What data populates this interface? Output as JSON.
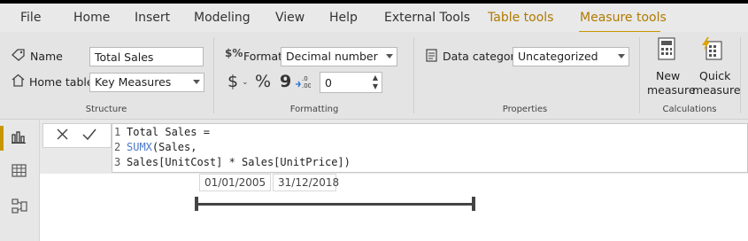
{
  "menu": {
    "items": [
      "File",
      "Home",
      "Insert",
      "Modeling",
      "View",
      "Help",
      "External Tools",
      "Table tools",
      "Measure tools"
    ],
    "active": "Measure tools"
  },
  "ribbon": {
    "structure": {
      "name_label": "Name",
      "name_value": "Total Sales",
      "home_table_label": "Home table",
      "home_table_value": "Key Measures",
      "title": "Structure"
    },
    "formatting": {
      "format_label": "Format",
      "format_value": "Decimal number",
      "currency_symbol": "$",
      "percent_symbol": "%",
      "comma_symbol": "9",
      "decimals_value": "0",
      "title": "Formatting"
    },
    "properties": {
      "data_category_label": "Data category",
      "data_category_value": "Uncategorized",
      "title": "Properties"
    },
    "calculations": {
      "new_measure_line1": "New",
      "new_measure_line2": "measure",
      "quick_measure_line1": "Quick",
      "quick_measure_line2": "measure",
      "title": "Calculations"
    }
  },
  "formula": {
    "lines": [
      {
        "num": "1",
        "text": "Total Sales ="
      },
      {
        "num": "2",
        "kw": "SUMX",
        "rest": "(Sales,"
      },
      {
        "num": "3",
        "text": "Sales[UnitCost] * Sales[UnitPrice])"
      }
    ]
  },
  "slicer": {
    "start_date": "01/01/2005",
    "end_date": "31/12/2018"
  },
  "colors": {
    "accent": "#c89700",
    "keyword": "#4a78c9"
  },
  "icons": [
    "tag-icon",
    "home-icon",
    "format-icon",
    "data-category-icon",
    "new-measure-icon",
    "quick-measure-icon",
    "close-icon",
    "check-icon",
    "report-view-icon",
    "data-view-icon",
    "model-view-icon"
  ]
}
